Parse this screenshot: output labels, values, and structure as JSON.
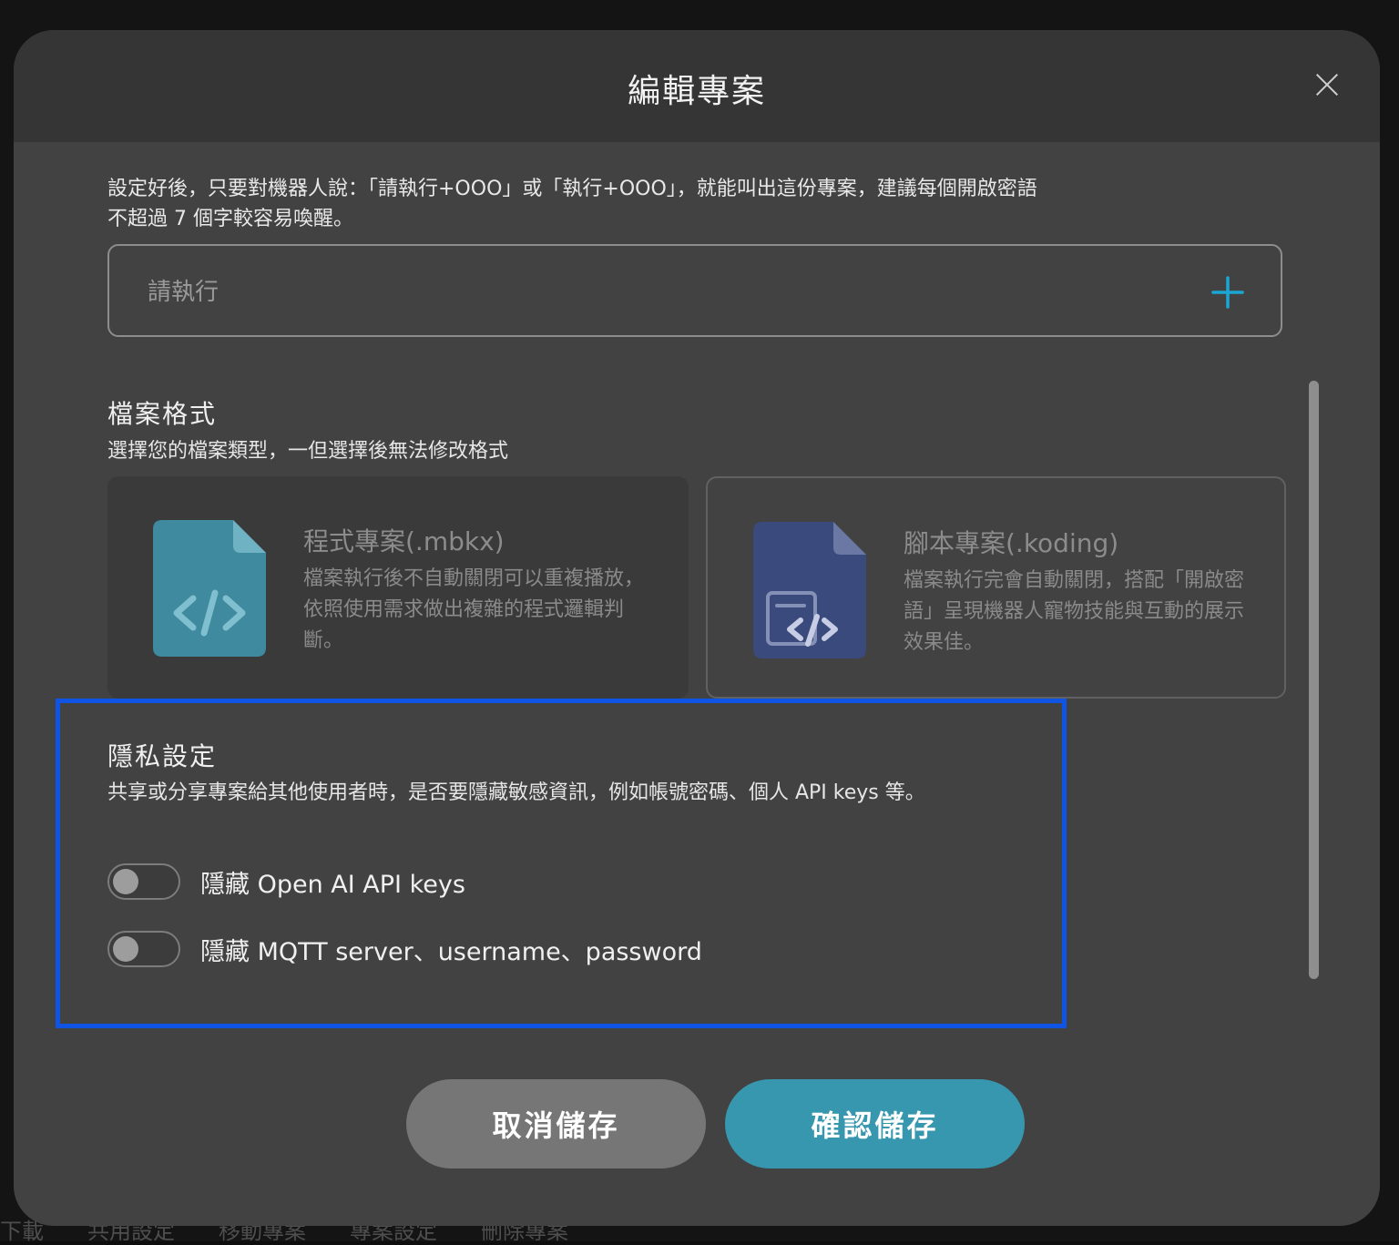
{
  "background": {
    "bottom_bar": [
      "下載",
      "共用設定",
      "移動專案",
      "專案設定",
      "刪除專案"
    ]
  },
  "modal": {
    "title": "編輯專案",
    "description": "設定好後，只要對機器人說：「請執行+OOO」或「執行+OOO」，就能叫出這份專案，建議每個開啟密語不超過 7 個字較容易喚醒。",
    "keyword_input": {
      "placeholder": "請執行",
      "value": ""
    }
  },
  "file_format": {
    "title": "檔案格式",
    "subtitle": "選擇您的檔案類型，一但選擇後無法修改格式",
    "options": [
      {
        "title": "程式專案(.mbkx)",
        "description": "檔案執行後不自動關閉可以重複播放，依照使用需求做出複雜的程式邏輯判斷。",
        "icon": "code-file-icon",
        "color": "#3f8a9e",
        "selected": true
      },
      {
        "title": "腳本專案(.koding)",
        "description": "檔案執行完會自動關閉，搭配「開啟密語」呈現機器人寵物技能與互動的展示效果佳。",
        "icon": "script-file-icon",
        "color": "#3a4a7c",
        "selected": false
      }
    ]
  },
  "privacy": {
    "title": "隱私設定",
    "subtitle": "共享或分享專案給其他使用者時，是否要隱藏敏感資訊，例如帳號密碼、個人 API keys 等。",
    "toggles": [
      {
        "label": "隱藏 Open AI API keys",
        "on": false
      },
      {
        "label": "隱藏 MQTT server、username、password",
        "on": false
      }
    ]
  },
  "actions": {
    "cancel_label": "取消儲存",
    "confirm_label": "確認儲存"
  },
  "colors": {
    "accent": "#3797ae",
    "highlight_border": "#1054e6",
    "add_icon": "#1ba7d4"
  }
}
